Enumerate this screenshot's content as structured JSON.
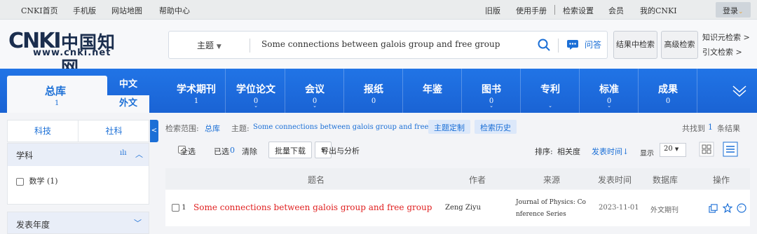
{
  "topbar": {
    "links_left": [
      "CNKI首页",
      "手机版",
      "网站地图",
      "帮助中心"
    ],
    "links_right": [
      "旧版",
      "使用手册",
      "检索设置",
      "会员",
      "我的CNKI"
    ],
    "login": "登录"
  },
  "logo": {
    "cn": "中国知网",
    "url": "www.cnki.net",
    "letters": "CNKI"
  },
  "search": {
    "field": "主题",
    "query": "Some connections between galois group and free group",
    "ask": "问答"
  },
  "header_buttons": {
    "in_results": "结果中检索",
    "advanced": "高级检索"
  },
  "side_links": {
    "knowledge": "知识元检索 >",
    "citation": "引文检索 >"
  },
  "db_tabs": {
    "main": {
      "label": "总库",
      "count": "1"
    },
    "zh": "中文",
    "en": "外文",
    "items": [
      {
        "label": "学术期刊",
        "count": "1",
        "arrow": ""
      },
      {
        "label": "学位论文",
        "count": "0",
        "arrow": "⌄"
      },
      {
        "label": "会议",
        "count": "0",
        "arrow": "⌄"
      },
      {
        "label": "报纸",
        "count": "0",
        "arrow": ""
      },
      {
        "label": "年鉴",
        "count": "",
        "arrow": ""
      },
      {
        "label": "图书",
        "count": "0",
        "arrow": "⌄"
      },
      {
        "label": "专利",
        "count": "",
        "arrow": "⌄"
      },
      {
        "label": "标准",
        "count": "0",
        "arrow": "⌄"
      },
      {
        "label": "成果",
        "count": "0",
        "arrow": ""
      }
    ]
  },
  "sidebar": {
    "tabs": [
      "科技",
      "社科"
    ],
    "subject": {
      "title": "学科",
      "items": [
        {
          "label": "数学 (1)"
        }
      ]
    },
    "year": {
      "title": "发表年度"
    }
  },
  "result_head": {
    "scope_label": "检索范围:",
    "scope_value": "总库",
    "topic_label": "主题:",
    "topic_value": "Some connections between galois group and free group",
    "customize": "主题定制",
    "history": "检索历史",
    "found_prefix": "共找到",
    "found_count": "1",
    "found_suffix": "条结果"
  },
  "toolbar": {
    "select_all": "全选",
    "selected": "已选",
    "selected_count": "0",
    "clear": "清除",
    "batch_download": "批量下载",
    "export": "导出与分析",
    "sort_label": "排序:",
    "sort_relevance": "相关度",
    "sort_date": "发表时间",
    "display_label": "显示",
    "page_size": "20"
  },
  "table": {
    "headers": [
      "题名",
      "作者",
      "来源",
      "发表时间",
      "数据库",
      "操作"
    ],
    "rows": [
      {
        "index": "1",
        "title": "Some connections between galois group and free group",
        "author": "Zeng Ziyu",
        "source_line1": "Journal of Physics: Co",
        "source_line2": "nference Series",
        "date": "2023-11-01",
        "database": "外文期刊"
      }
    ]
  },
  "colors": {
    "brand_blue": "#1b6fd6",
    "title_red": "#e02020",
    "nav_blue": "#1f6fe0"
  }
}
